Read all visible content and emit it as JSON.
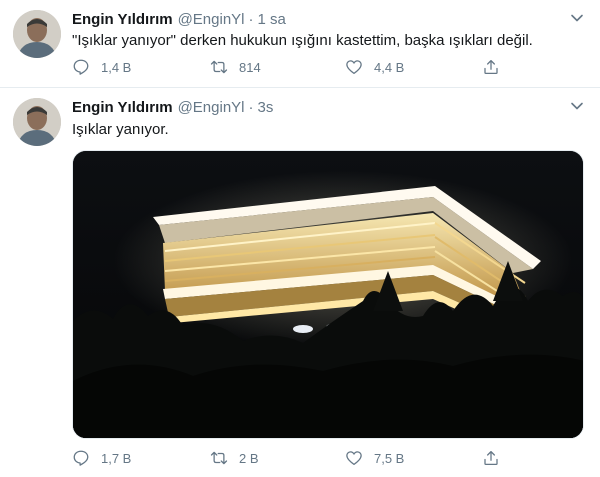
{
  "tweets": [
    {
      "name": "Engin Yıldırım",
      "handle": "@EnginYl",
      "separator": "·",
      "time": "1 sa",
      "text": "\"Işıklar yanıyor\" derken hukukun ışığını kastettim, başka ışıkları değil.",
      "replies": "1,4 B",
      "retweets": "814",
      "likes": "4,4 B"
    },
    {
      "name": "Engin Yıldırım",
      "handle": "@EnginYl",
      "separator": "·",
      "time": "3s",
      "text": "Işıklar yanıyor.",
      "replies": "1,7 B",
      "retweets": "2 B",
      "likes": "7,5 B"
    }
  ],
  "icons": {
    "reply": "reply-icon",
    "retweet": "retweet-icon",
    "like": "heart-icon",
    "share": "share-icon",
    "more": "chevron-down-icon"
  },
  "colors": {
    "secondary_text": "#657786",
    "divider": "#e6ecf0",
    "primary_text": "#14171a"
  }
}
